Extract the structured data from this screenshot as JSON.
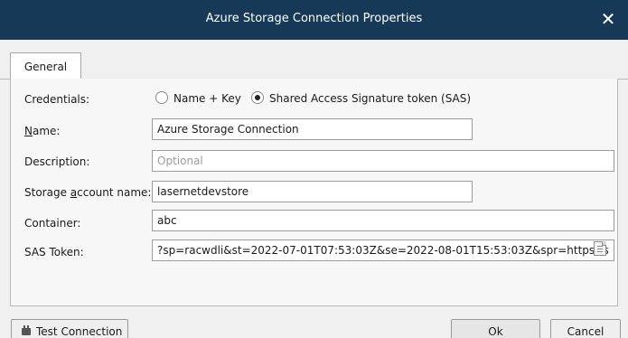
{
  "window": {
    "title": "Azure Storage Connection Properties",
    "close_glyph": "✕"
  },
  "tabs": [
    {
      "label": "General"
    }
  ],
  "form": {
    "credentials_label": "Credentials:",
    "credentials_options": [
      {
        "label": "Name + Key",
        "selected": false
      },
      {
        "label": "Shared Access Signature token (SAS)",
        "selected": true
      }
    ],
    "name_label": "Name:",
    "name_value": "Azure Storage Connection",
    "description_label": "Description:",
    "description_placeholder": "Optional",
    "storage_account_label": "Storage account name:",
    "storage_account_value": "lasernetdevstore",
    "container_label": "Container:",
    "container_value": "abc",
    "sas_token_label": "SAS Token:",
    "sas_token_value": "?sp=racwdli&st=2022-07-01T07:53:03Z&se=2022-08-01T15:53:03Z&spr=https&s"
  },
  "buttons": {
    "test_connection": "Test Connection",
    "ok": "Ok",
    "cancel": "Cancel"
  },
  "icons": {
    "close": "close-icon",
    "plug": "plug-icon",
    "token": "clipboard-icon"
  }
}
